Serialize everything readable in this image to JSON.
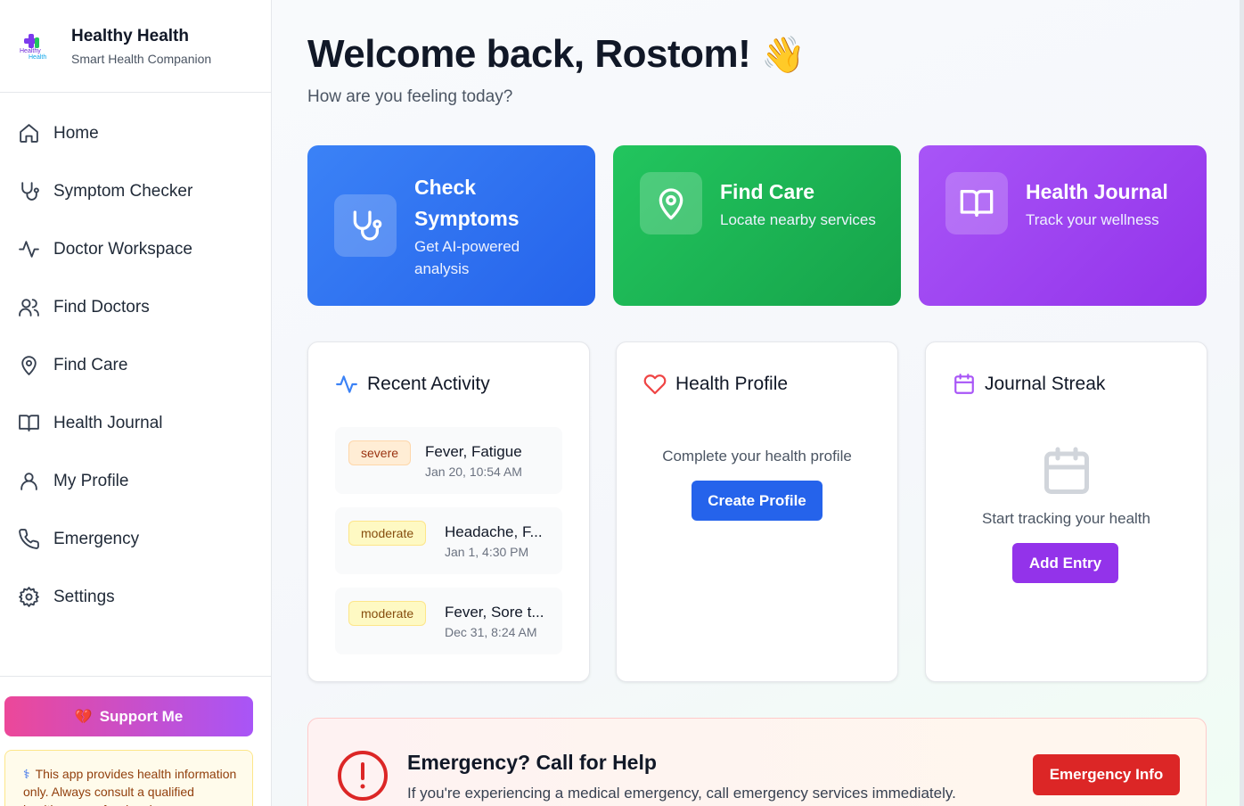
{
  "brand": {
    "title": "Healthy Health",
    "subtitle": "Smart Health Companion",
    "logo_text_1": "Healthy",
    "logo_text_2": "Health"
  },
  "nav": [
    {
      "label": "Home",
      "icon": "home-icon"
    },
    {
      "label": "Symptom Checker",
      "icon": "stethoscope-icon"
    },
    {
      "label": "Doctor Workspace",
      "icon": "activity-icon"
    },
    {
      "label": "Find Doctors",
      "icon": "users-icon"
    },
    {
      "label": "Find Care",
      "icon": "map-pin-icon"
    },
    {
      "label": "Health Journal",
      "icon": "book-open-icon"
    },
    {
      "label": "My Profile",
      "icon": "user-icon"
    },
    {
      "label": "Emergency",
      "icon": "phone-icon"
    },
    {
      "label": "Settings",
      "icon": "gear-icon"
    }
  ],
  "support": {
    "label": "Support Me",
    "emoji": "💔"
  },
  "disclaimer": {
    "icon": "⚕",
    "text": "This app provides health information only. Always consult a qualified healthcare professional."
  },
  "header": {
    "welcome": "Welcome back, Rostom!",
    "wave": "👋",
    "subtitle": "How are you feeling today?"
  },
  "quick_actions": [
    {
      "title_line1": "Check",
      "title_line2": "Symptoms",
      "subtitle_line1": "Get AI-powered",
      "subtitle_line2": "analysis",
      "color": "#3b82f6"
    },
    {
      "title": "Find Care",
      "subtitle": "Locate nearby services",
      "color": "#22c55e"
    },
    {
      "title": "Health Journal",
      "subtitle": "Track your wellness",
      "color": "#a855f7"
    }
  ],
  "recent_activity": {
    "title": "Recent Activity",
    "items": [
      {
        "severity": "severe",
        "symptoms": "Fever, Fatigue",
        "time": "Jan 20, 10:54 AM"
      },
      {
        "severity": "moderate",
        "symptoms": "Headache, F...",
        "time": "Jan 1, 4:30 PM"
      },
      {
        "severity": "moderate",
        "symptoms": "Fever, Sore t...",
        "time": "Dec 31, 8:24 AM"
      }
    ]
  },
  "health_profile": {
    "title": "Health Profile",
    "message": "Complete your health profile",
    "button": "Create Profile"
  },
  "journal_streak": {
    "title": "Journal Streak",
    "message": "Start tracking your health",
    "button": "Add Entry"
  },
  "emergency": {
    "title": "Emergency? Call for Help",
    "subtitle": "If you're experiencing a medical emergency, call emergency services immediately.",
    "button": "Emergency Info"
  }
}
